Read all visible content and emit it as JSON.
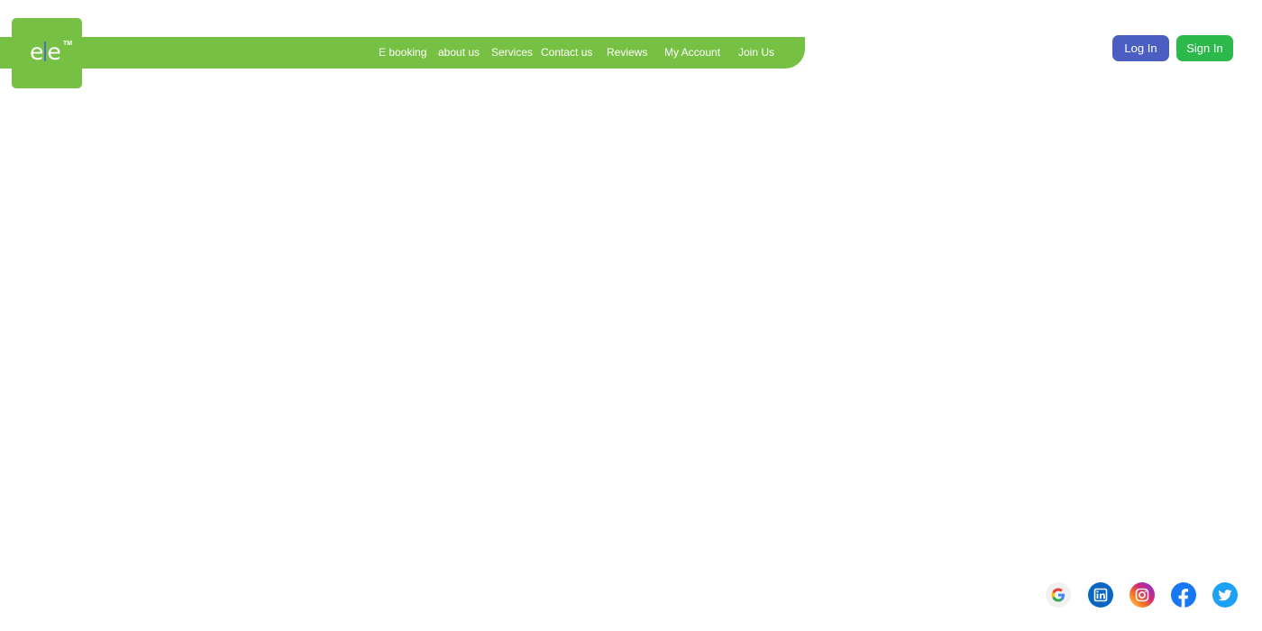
{
  "logo": {
    "text_left": "e",
    "text_right": "e",
    "trademark": "TM"
  },
  "nav": {
    "items": [
      {
        "label": "E booking"
      },
      {
        "label": "about us"
      },
      {
        "label": "Services"
      },
      {
        "label": "Contact us"
      },
      {
        "label": "Reviews"
      },
      {
        "label": "My Account"
      },
      {
        "label": "Join Us"
      }
    ]
  },
  "auth": {
    "login_label": "Log In",
    "signin_label": "Sign In"
  },
  "social": {
    "icons": [
      "google-icon",
      "linkedin-icon",
      "instagram-icon",
      "facebook-icon",
      "twitter-icon"
    ]
  },
  "colors": {
    "brand_green": "#76c043",
    "login_blue": "#4a5fc1",
    "signin_green": "#2db84c"
  }
}
